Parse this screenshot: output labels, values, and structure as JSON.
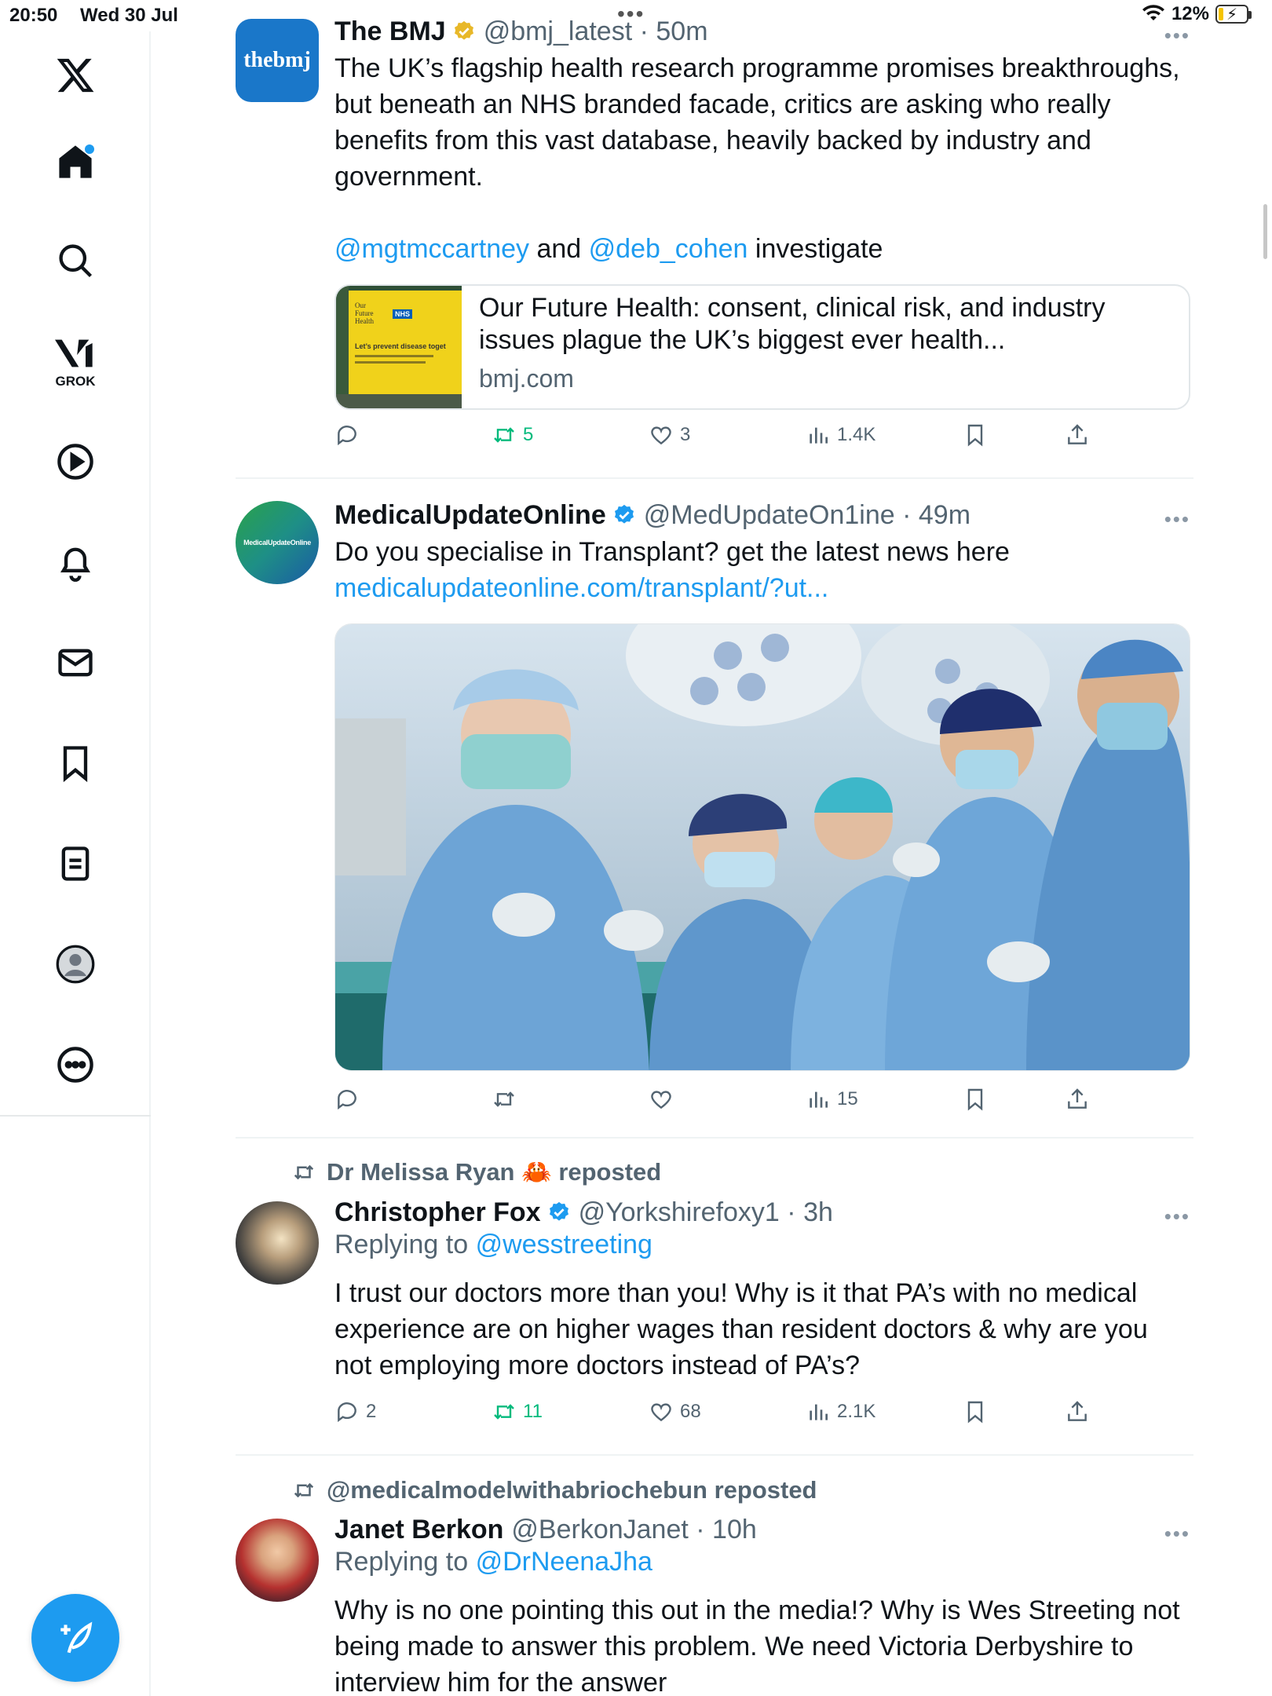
{
  "status_bar": {
    "time": "20:50",
    "date": "Wed 30 Jul",
    "battery": "12%"
  },
  "sidebar": {
    "grok_label": "GROK",
    "items": [
      "x-logo",
      "home",
      "search",
      "grok",
      "video",
      "notifications",
      "messages",
      "bookmarks",
      "lists",
      "profile",
      "more"
    ]
  },
  "tweets": [
    {
      "name": "The BMJ",
      "verified": "gold",
      "handle": "@bmj_latest",
      "time": "50m",
      "avatar_text": "thebmj",
      "text": "The UK’s flagship health research programme promises breakthroughs, but beneath an NHS branded facade, critics are asking who really benefits from this vast database, heavily backed by industry and government.",
      "mention1": "@mgtmccartney",
      "and": "and",
      "mention2": "@deb_cohen",
      "tail": "investigate",
      "card": {
        "title": "Our Future Health: consent, clinical risk, and industry issues plague the UK’s biggest ever health...",
        "domain": "bmj.com",
        "img_sign_line1": "Our",
        "img_sign_line2": "Future",
        "img_sign_line3": "Health",
        "img_nhs": "NHS",
        "img_headline": "Let’s prevent disease toget"
      },
      "replies": "",
      "reposts": "5",
      "likes": "3",
      "views": "1.4K"
    },
    {
      "name": "MedicalUpdateOnline",
      "verified": "blue",
      "handle": "@MedUpdateOn1ine",
      "time": "49m",
      "avatar_text": "MedicalUpdateOnline",
      "text": "Do you specialise in Transplant? get the latest news here",
      "link": "medicalupdateonline.com/transplant/?ut...",
      "replies": "",
      "reposts": "",
      "likes": "",
      "views": "15"
    },
    {
      "reposted_by": "Dr Melissa Ryan 🦀 reposted",
      "name": "Christopher Fox",
      "verified": "blue",
      "handle": "@Yorkshirefoxy1",
      "time": "3h",
      "replying_label": "Replying to",
      "replying_to": "@wesstreeting",
      "text": "I trust our doctors more than you!  Why is it that PA’s with no medical experience are on higher wages than resident doctors & why are you not employing more doctors instead of PA’s?",
      "replies": "2",
      "reposts": "11",
      "likes": "68",
      "views": "2.1K"
    },
    {
      "reposted_by": "@medicalmodelwithabriochebun reposted",
      "name": "Janet Berkon",
      "handle": "@BerkonJanet",
      "time": "10h",
      "replying_label": "Replying to",
      "replying_to": "@DrNeenaJha",
      "text": "Why is no one pointing this out in the media!? Why is Wes Streeting not being made to answer this problem. We need Victoria Derbyshire to interview him for the answer"
    }
  ],
  "colors": {
    "accent": "#1d9bf0",
    "repost_green": "#00ba7c",
    "muted": "#536471",
    "bmj_blue": "#1a77c9",
    "gold_badge": "#e8b829"
  }
}
